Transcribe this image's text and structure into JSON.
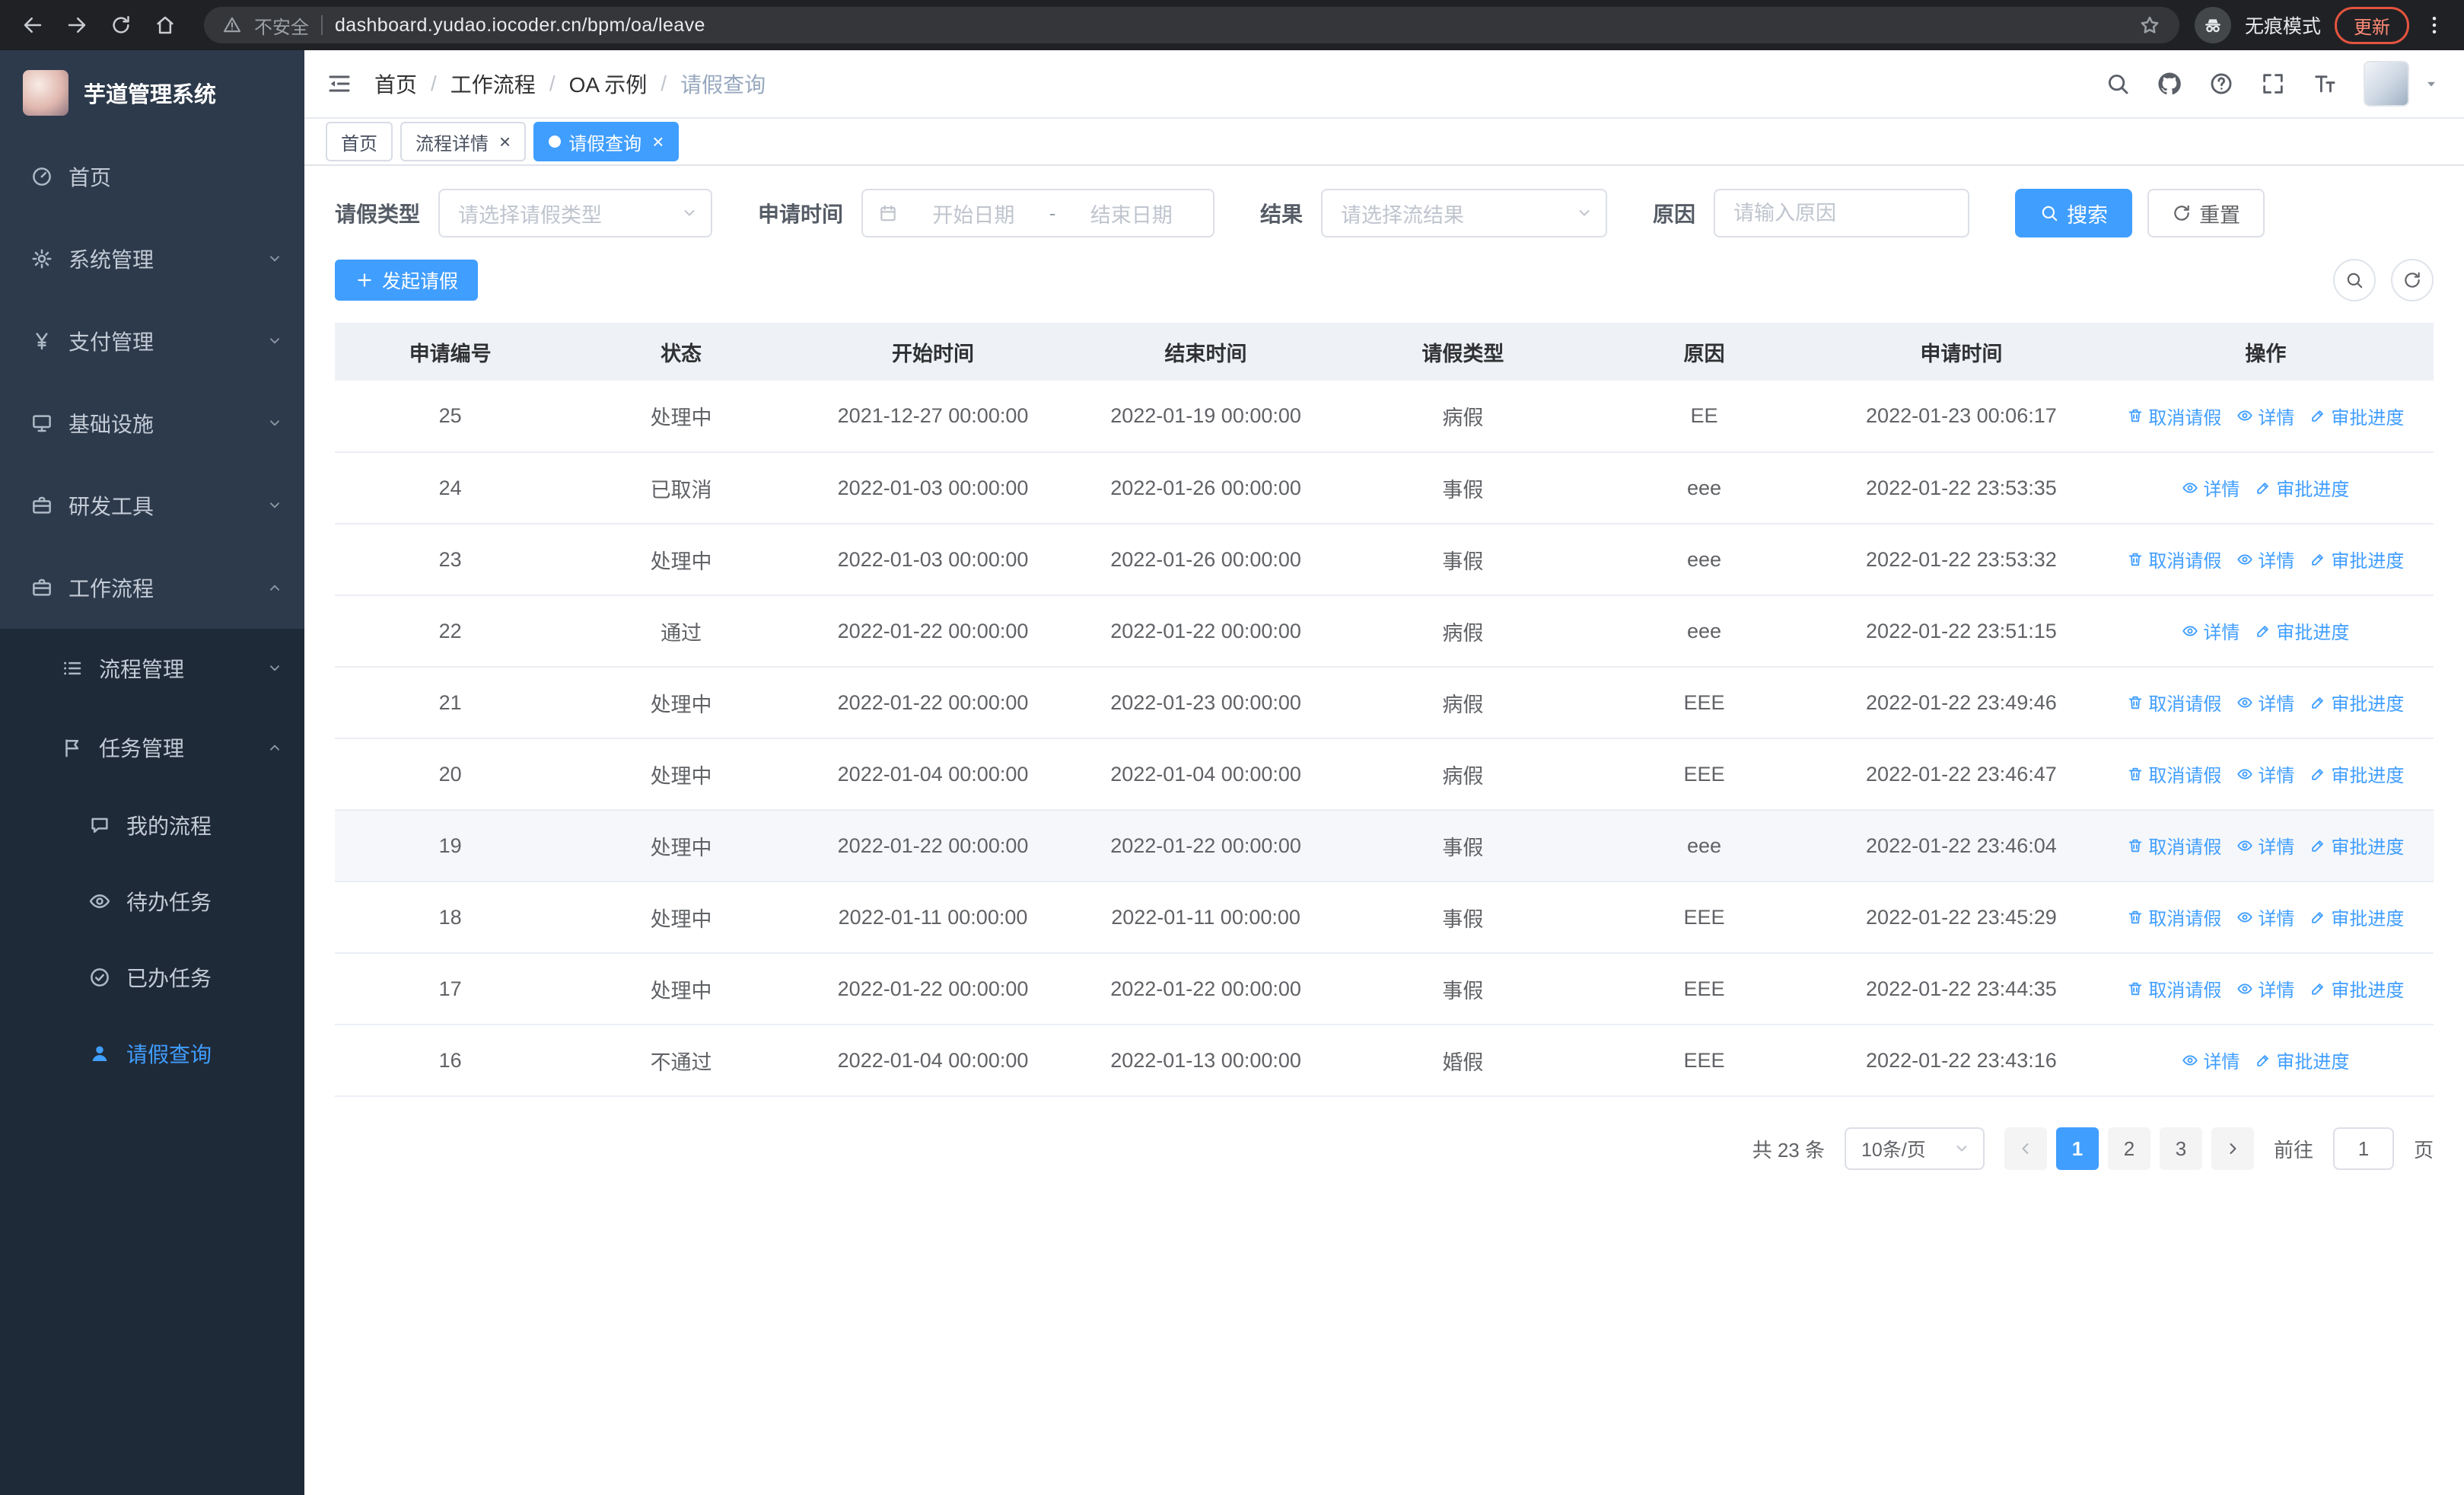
{
  "colors": {
    "primary": "#409eff",
    "sidebar_bg": "#2d3a4b",
    "submenu_bg": "#1f2a38",
    "table_header_bg": "#eef1f6",
    "active_tab_bg": "#409eff",
    "update_accent": "#e3543f"
  },
  "browser": {
    "security_label": "不安全",
    "url": "dashboard.yudao.iocoder.cn/bpm/oa/leave",
    "incognito_label": "无痕模式",
    "update_label": "更新"
  },
  "sidebar": {
    "logo_title": "芋道管理系统",
    "items": [
      {
        "key": "home",
        "label": "首页",
        "icon": "dashboard",
        "level": 1
      },
      {
        "key": "system-mgmt",
        "label": "系统管理",
        "icon": "gear",
        "level": 1,
        "chevron": "down"
      },
      {
        "key": "payment-mgmt",
        "label": "支付管理",
        "icon": "yen",
        "level": 1,
        "chevron": "down"
      },
      {
        "key": "infrastructure",
        "label": "基础设施",
        "icon": "infra",
        "level": 1,
        "chevron": "down"
      },
      {
        "key": "dev-tools",
        "label": "研发工具",
        "icon": "briefcase",
        "level": 1,
        "chevron": "down"
      },
      {
        "key": "workflow",
        "label": "工作流程",
        "icon": "briefcase",
        "level": 1,
        "chevron": "up"
      },
      {
        "key": "process-mgmt",
        "label": "流程管理",
        "icon": "process",
        "level": 2,
        "chevron": "down"
      },
      {
        "key": "task-mgmt",
        "label": "任务管理",
        "icon": "task",
        "level": 2,
        "chevron": "up"
      },
      {
        "key": "my-process",
        "label": "我的流程",
        "icon": "chat",
        "level": 3
      },
      {
        "key": "todo-tasks",
        "label": "待办任务",
        "icon": "eye",
        "level": 3
      },
      {
        "key": "done-tasks",
        "label": "已办任务",
        "icon": "done",
        "level": 3
      },
      {
        "key": "leave-query",
        "label": "请假查询",
        "icon": "user",
        "level": 3,
        "active": true
      }
    ]
  },
  "header": {
    "breadcrumbs": [
      "首页",
      "工作流程",
      "OA 示例",
      "请假查询"
    ],
    "separator": "/"
  },
  "tabs": [
    {
      "key": "home",
      "label": "首页",
      "active": false,
      "closable": false
    },
    {
      "key": "process-detail",
      "label": "流程详情",
      "active": false,
      "closable": true
    },
    {
      "key": "leave-query",
      "label": "请假查询",
      "active": true,
      "closable": true
    }
  ],
  "filters": {
    "leave_type_label": "请假类型",
    "leave_type_placeholder": "请选择请假类型",
    "apply_time_label": "申请时间",
    "start_date_placeholder": "开始日期",
    "range_separator": "-",
    "end_date_placeholder": "结束日期",
    "result_label": "结果",
    "result_placeholder": "请选择流结果",
    "reason_label": "原因",
    "reason_placeholder": "请输入原因",
    "search_label": "搜索",
    "reset_label": "重置"
  },
  "toolbar": {
    "create_label": "发起请假"
  },
  "actions": {
    "cancel": "取消请假",
    "detail": "详情",
    "progress": "审批进度"
  },
  "table": {
    "columns": [
      {
        "key": "id",
        "label": "申请编号"
      },
      {
        "key": "status",
        "label": "状态"
      },
      {
        "key": "start",
        "label": "开始时间"
      },
      {
        "key": "end",
        "label": "结束时间"
      },
      {
        "key": "type",
        "label": "请假类型"
      },
      {
        "key": "reason",
        "label": "原因"
      },
      {
        "key": "applied",
        "label": "申请时间"
      },
      {
        "key": "ops",
        "label": "操作"
      }
    ],
    "rows": [
      {
        "id": "25",
        "status": "处理中",
        "start": "2021-12-27 00:00:00",
        "end": "2022-01-19 00:00:00",
        "type": "病假",
        "reason": "EE",
        "applied": "2022-01-23 00:06:17",
        "cancellable": true,
        "highlight": false
      },
      {
        "id": "24",
        "status": "已取消",
        "start": "2022-01-03 00:00:00",
        "end": "2022-01-26 00:00:00",
        "type": "事假",
        "reason": "eee",
        "applied": "2022-01-22 23:53:35",
        "cancellable": false,
        "highlight": false
      },
      {
        "id": "23",
        "status": "处理中",
        "start": "2022-01-03 00:00:00",
        "end": "2022-01-26 00:00:00",
        "type": "事假",
        "reason": "eee",
        "applied": "2022-01-22 23:53:32",
        "cancellable": true,
        "highlight": false
      },
      {
        "id": "22",
        "status": "通过",
        "start": "2022-01-22 00:00:00",
        "end": "2022-01-22 00:00:00",
        "type": "病假",
        "reason": "eee",
        "applied": "2022-01-22 23:51:15",
        "cancellable": false,
        "highlight": false
      },
      {
        "id": "21",
        "status": "处理中",
        "start": "2022-01-22 00:00:00",
        "end": "2022-01-23 00:00:00",
        "type": "病假",
        "reason": "EEE",
        "applied": "2022-01-22 23:49:46",
        "cancellable": true,
        "highlight": false
      },
      {
        "id": "20",
        "status": "处理中",
        "start": "2022-01-04 00:00:00",
        "end": "2022-01-04 00:00:00",
        "type": "病假",
        "reason": "EEE",
        "applied": "2022-01-22 23:46:47",
        "cancellable": true,
        "highlight": false
      },
      {
        "id": "19",
        "status": "处理中",
        "start": "2022-01-22 00:00:00",
        "end": "2022-01-22 00:00:00",
        "type": "事假",
        "reason": "eee",
        "applied": "2022-01-22 23:46:04",
        "cancellable": true,
        "highlight": true
      },
      {
        "id": "18",
        "status": "处理中",
        "start": "2022-01-11 00:00:00",
        "end": "2022-01-11 00:00:00",
        "type": "事假",
        "reason": "EEE",
        "applied": "2022-01-22 23:45:29",
        "cancellable": true,
        "highlight": false
      },
      {
        "id": "17",
        "status": "处理中",
        "start": "2022-01-22 00:00:00",
        "end": "2022-01-22 00:00:00",
        "type": "事假",
        "reason": "EEE",
        "applied": "2022-01-22 23:44:35",
        "cancellable": true,
        "highlight": false
      },
      {
        "id": "16",
        "status": "不通过",
        "start": "2022-01-04 00:00:00",
        "end": "2022-01-13 00:00:00",
        "type": "婚假",
        "reason": "EEE",
        "applied": "2022-01-22 23:43:16",
        "cancellable": false,
        "highlight": false
      }
    ]
  },
  "pagination": {
    "total_text": "共 23 条",
    "page_size": "10条/页",
    "pages": [
      "1",
      "2",
      "3"
    ],
    "active_page": "1",
    "goto_label": "前往",
    "goto_value": "1",
    "page_label": "页"
  },
  "icons": {
    "back-icon": "arrow-left",
    "forward-icon": "arrow-right",
    "reload-icon": "circular-arrow",
    "home-icon": "house",
    "warning-icon": "triangle-exclaim",
    "bookmark-star-icon": "star-outline",
    "incognito-icon": "hat-glasses",
    "menu-dots-icon": "three-dots",
    "collapse-sidebar-icon": "indent-lines",
    "search-icon": "magnifier",
    "github-icon": "octocat",
    "help-icon": "question-circle",
    "fullscreen-icon": "corner-brackets",
    "font-size-icon": "double-T",
    "caret-down-icon": "triangle-down",
    "dashboard-icon": "gauge",
    "gear-icon": "cog",
    "yen-icon": "yen-sign",
    "infra-icon": "monitor",
    "briefcase-icon": "briefcase",
    "process-icon": "list",
    "task-icon": "flag",
    "chat-icon": "speech-bubble",
    "eye-icon": "eye",
    "done-icon": "check-circle",
    "user-icon": "person",
    "calendar-icon": "calendar",
    "refresh-icon": "circular-arrow",
    "plus-icon": "plus",
    "trash-icon": "trash",
    "pen-icon": "pencil"
  }
}
